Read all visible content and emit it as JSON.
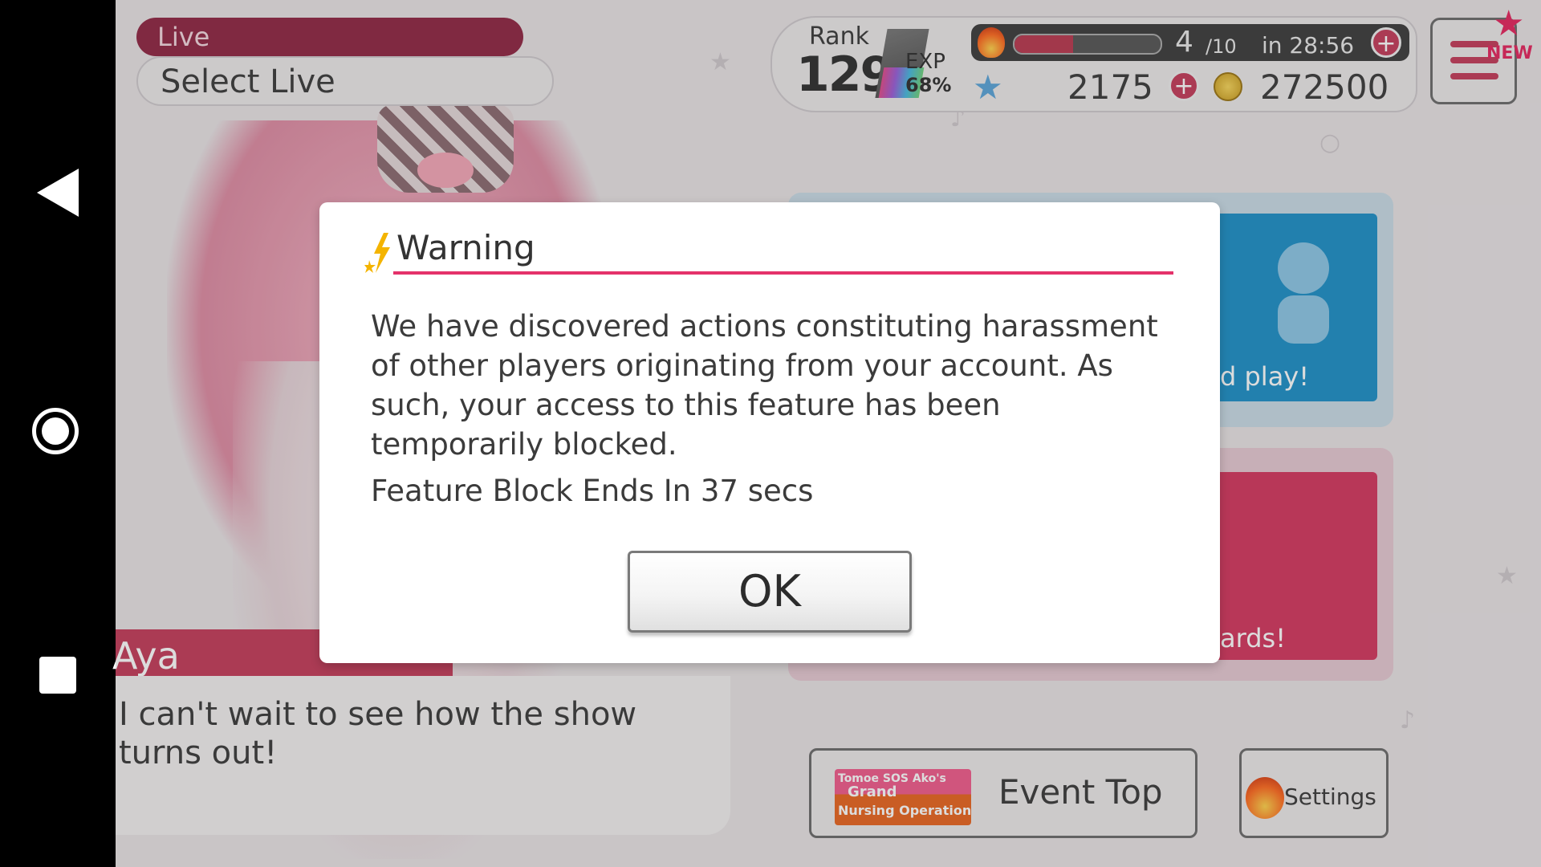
{
  "header": {
    "live_tab": "Live",
    "title": "Select Live"
  },
  "status": {
    "rank_label": "Rank",
    "rank": "129",
    "exp_label": "EXP",
    "exp_percent": "68%",
    "stamina_current": "4",
    "stamina_max": "/10",
    "stamina_timer": "in 28:56",
    "stamina_fraction": 0.4,
    "stars": "2175",
    "coins": "272500",
    "plus": "+"
  },
  "menu": {
    "badge": "NEW"
  },
  "character": {
    "name": "Aya",
    "dialogue": "I can't wait to see how the show turns out!"
  },
  "tiles": {
    "top_label": "d play!",
    "bottom_label": "ards!"
  },
  "buttons": {
    "event_logo_line1": "Tomoe SOS Ako's",
    "event_logo_line2": "Grand",
    "event_logo_line3": "Nursing Operation",
    "event_top": "Event Top",
    "settings": "Settings"
  },
  "modal": {
    "title": "Warning",
    "body": "We have discovered actions constituting harassment of other players originating from your account. As such, your access to this feature has been temporarily blocked.",
    "timer": "Feature Block Ends In 37 secs",
    "ok": "OK"
  },
  "colors": {
    "accent": "#e4326a",
    "live_tab": "#8f2542",
    "tile_blue": "#1d8fc7",
    "tile_pink": "#d4365f"
  }
}
